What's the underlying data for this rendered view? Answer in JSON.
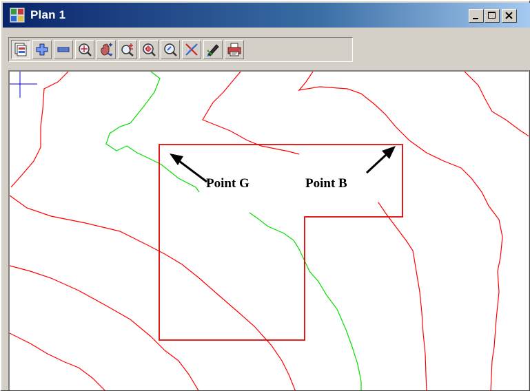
{
  "window": {
    "title": "Plan 1",
    "controls": {
      "minimize_icon": "minimize-icon",
      "maximize_icon": "maximize-icon",
      "close_icon": "close-icon"
    }
  },
  "toolbar": {
    "tools": [
      {
        "name": "plot-views-tool",
        "icon": "layers-icon",
        "pressed": true
      },
      {
        "name": "zoom-in-tool",
        "icon": "plus-icon"
      },
      {
        "name": "zoom-out-tool",
        "icon": "minus-icon"
      },
      {
        "name": "zoom-extent-tool",
        "icon": "magnifier-extent-icon"
      },
      {
        "name": "pan-tool",
        "icon": "hand-icon"
      },
      {
        "name": "zoom-window-tool",
        "icon": "magnifier-plusminus-icon"
      },
      {
        "name": "zoom-center-tool",
        "icon": "magnifier-target-icon"
      },
      {
        "name": "zoom-previous-tool",
        "icon": "magnifier-icon"
      },
      {
        "name": "snap-tool",
        "icon": "cross-snap-icon"
      },
      {
        "name": "pick-tool",
        "icon": "pen-icon"
      },
      {
        "name": "plot-tool",
        "icon": "printer-icon"
      }
    ]
  },
  "canvas": {
    "background": "#ffffff",
    "contour_color": "#ff0000",
    "green_line_color": "#00dd00",
    "boundary_color": "#dd0000",
    "cursor_color": "#0000cc",
    "annotations": {
      "point_g": "Point G",
      "point_b": "Point B"
    }
  }
}
